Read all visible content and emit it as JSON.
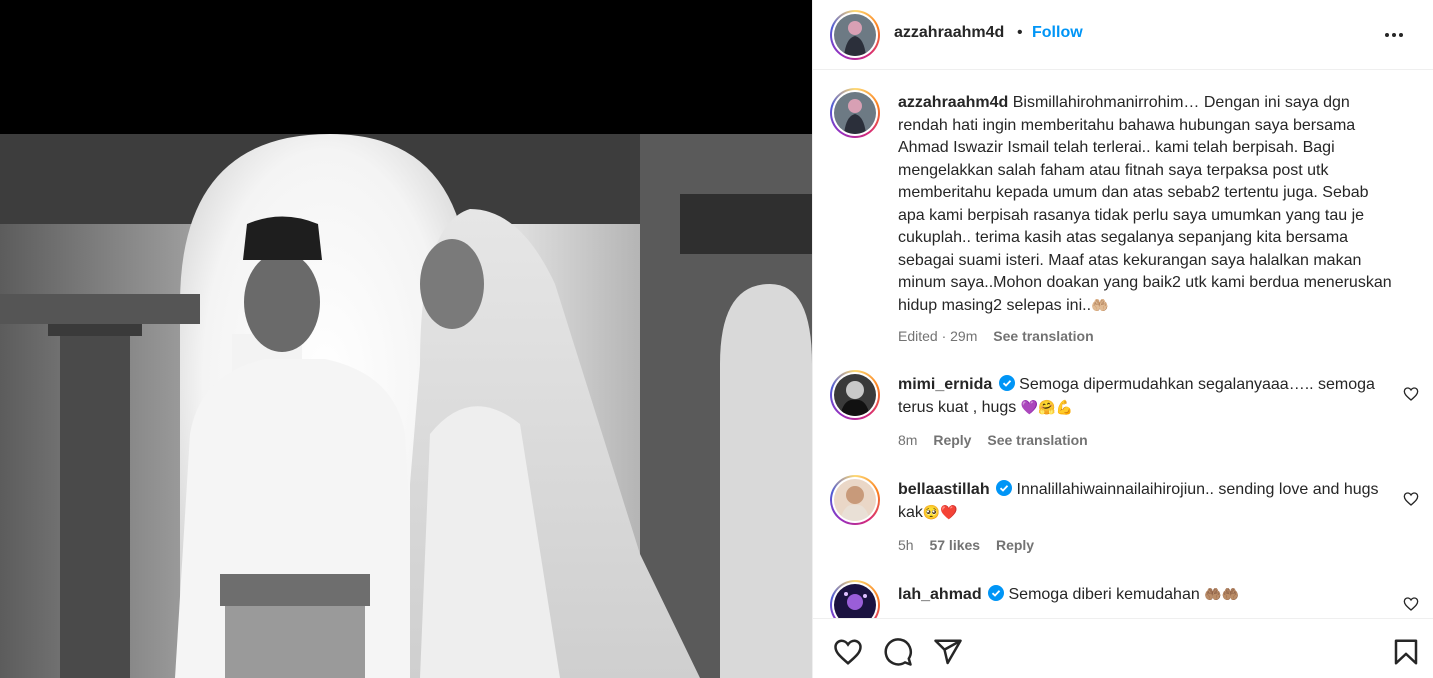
{
  "header": {
    "username": "azzahraahm4d",
    "separator": "•",
    "follow_label": "Follow",
    "more_icon": "more-horizontal-icon"
  },
  "caption": {
    "username": "azzahraahm4d",
    "text": "Bismillahirohmanirrohim… Dengan ini saya dgn rendah hati ingin memberitahu bahawa hubungan saya bersama Ahmad Iswazir Ismail telah terlerai.. kami telah berpisah. Bagi mengelakkan salah faham atau fitnah saya terpaksa post utk memberitahu kepada umum dan atas sebab2 tertentu juga. Sebab apa kami berpisah rasanya tidak perlu saya umumkan yang tau je cukuplah.. terima kasih atas segalanya sepanjang kita bersama sebagai suami isteri. Maaf atas kekurangan saya halalkan makan minum saya..Mohon doakan yang baik2 utk kami berdua meneruskan hidup masing2 selepas ini..",
    "emoji": "🤲🏼",
    "edited": "Edited · 29m",
    "see_translation": "See translation"
  },
  "comments": [
    {
      "username": "mimi_ernida",
      "verified": true,
      "text": "Semoga dipermudahkan segalanyaaa….. semoga terus kuat , hugs",
      "emoji": "💜🤗💪",
      "time": "8m",
      "likes": "",
      "reply": "Reply",
      "see_translation": "See translation"
    },
    {
      "username": "bellaastillah",
      "verified": true,
      "text": "Innalillahiwainnailaihirojiun.. sending love and hugs kak",
      "emoji": "🥺❤️",
      "time": "5h",
      "likes": "57 likes",
      "reply": "Reply",
      "see_translation": ""
    },
    {
      "username": "lah_ahmad",
      "verified": true,
      "text": "Semoga diberi kemudahan",
      "emoji": "🤲🏽🤲🏽",
      "time": "",
      "likes": "",
      "reply": "",
      "see_translation": ""
    }
  ],
  "actions": {
    "like_icon": "heart-icon",
    "comment_icon": "comment-icon",
    "share_icon": "share-icon",
    "save_icon": "bookmark-icon"
  },
  "colors": {
    "follow_blue": "#0095f6",
    "verified_blue": "#0095f6",
    "meta_gray": "#737373",
    "text": "#262626"
  }
}
